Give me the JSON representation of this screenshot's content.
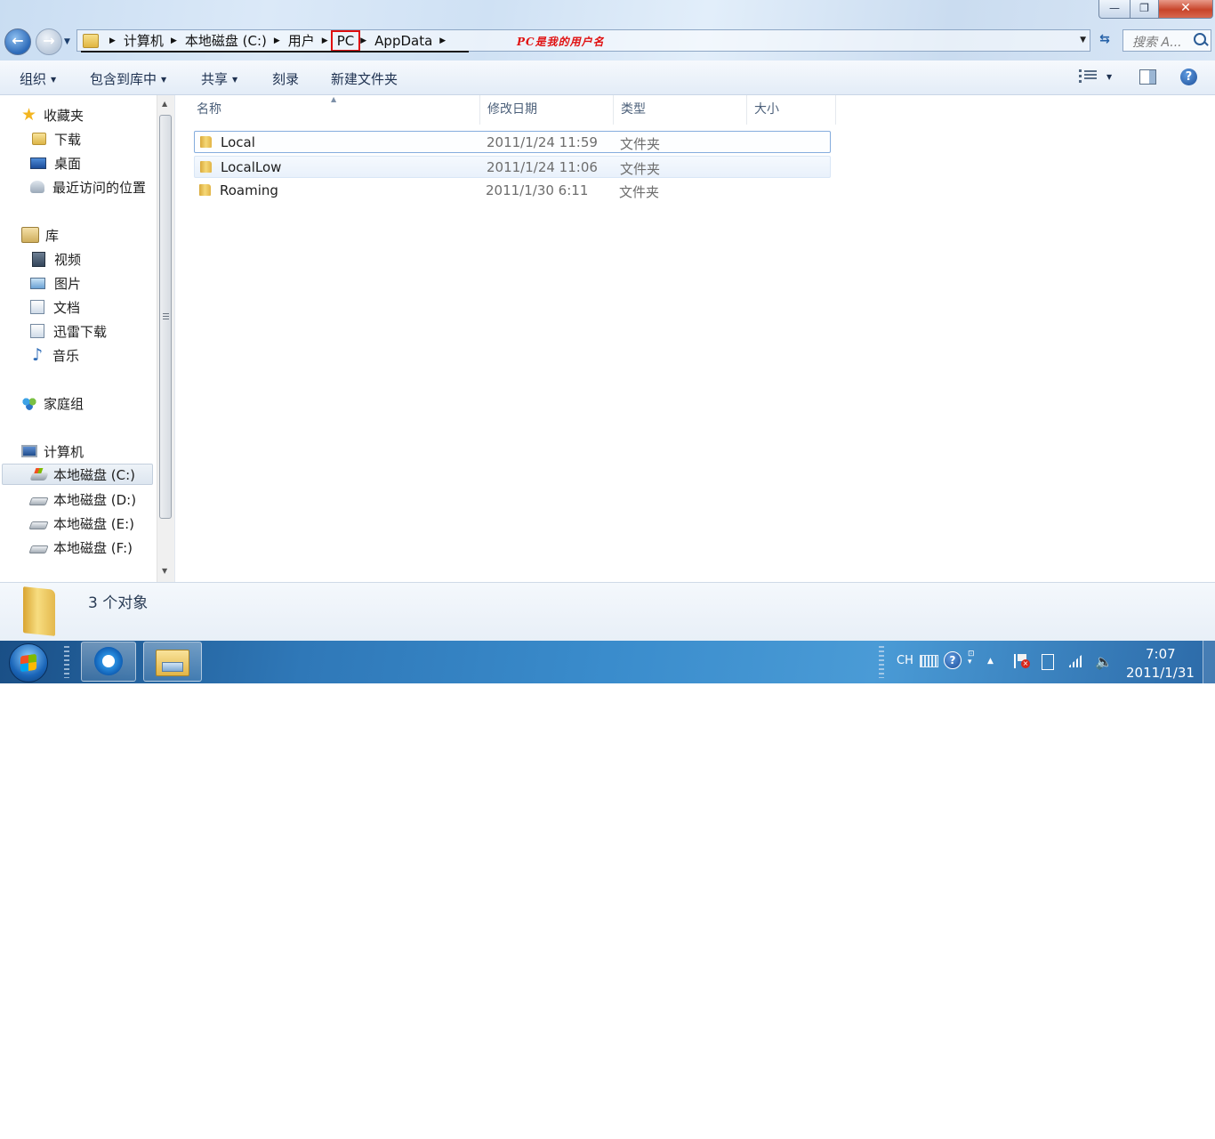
{
  "window": {
    "controls": {
      "minimize": "—",
      "maximize": "❐",
      "close": "✕"
    }
  },
  "nav": {
    "back": "←",
    "forward": "→"
  },
  "address": {
    "crumbs": [
      "计算机",
      "本地磁盘 (C:)",
      "用户",
      "PC",
      "AppData"
    ],
    "highlighted_index": 3,
    "annotation": "PC是我的用户名"
  },
  "search": {
    "placeholder": "搜索 A..."
  },
  "toolbar": {
    "organize": "组织",
    "include_in_library": "包含到库中",
    "share": "共享",
    "burn": "刻录",
    "new_folder": "新建文件夹",
    "help": "?"
  },
  "navpane": {
    "favorites": "收藏夹",
    "downloads": "下载",
    "desktop": "桌面",
    "recent": "最近访问的位置",
    "libraries": "库",
    "videos": "视频",
    "pictures": "图片",
    "documents": "文档",
    "xunlei": "迅雷下载",
    "music": "音乐",
    "homegroup": "家庭组",
    "computer": "计算机",
    "drive_c": "本地磁盘 (C:)",
    "drive_d": "本地磁盘 (D:)",
    "drive_e": "本地磁盘 (E:)",
    "drive_f": "本地磁盘 (F:)"
  },
  "columns": {
    "name": "名称",
    "modified": "修改日期",
    "type": "类型",
    "size": "大小"
  },
  "files": [
    {
      "name": "Local",
      "modified": "2011/1/24 11:59",
      "type": "文件夹"
    },
    {
      "name": "LocalLow",
      "modified": "2011/1/24 11:06",
      "type": "文件夹"
    },
    {
      "name": "Roaming",
      "modified": "2011/1/30 6:11",
      "type": "文件夹"
    }
  ],
  "details": {
    "count": "3 个对象"
  },
  "taskbar": {
    "lang": "CH",
    "help_glyph": "?",
    "clock_time": "7:07",
    "clock_date": "2011/1/31"
  }
}
